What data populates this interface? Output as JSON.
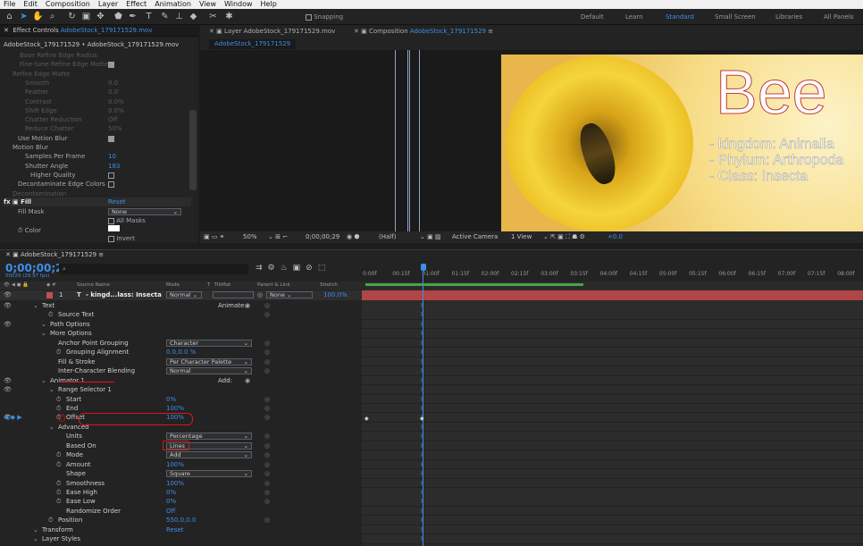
{
  "menu": [
    "File",
    "Edit",
    "Composition",
    "Layer",
    "Effect",
    "Animation",
    "View",
    "Window",
    "Help"
  ],
  "toolbar": {
    "snapping": "Snapping",
    "workspaces": [
      "Default",
      "Learn",
      "Standard",
      "Small Screen",
      "Libraries",
      "All Panels"
    ],
    "active_workspace": "Standard"
  },
  "effect_panel": {
    "tab_label": "Effect Controls",
    "tab_file": "AdobeStock_179171529.mov",
    "path": "AdobeStock_179171529 • AdobeStock_179171529.mov",
    "rows": [
      {
        "label": "Base Refine Edge Radius",
        "value": "",
        "dim": true
      },
      {
        "label": "Fine-tune Refine Edge Matte",
        "value": "",
        "dim": true
      },
      {
        "label": "Refine Edge Matte",
        "value": "",
        "dim": true
      },
      {
        "label": "Smooth",
        "value": "0.0",
        "dim": true
      },
      {
        "label": "Feather",
        "value": "0.0",
        "dim": true
      },
      {
        "label": "Contrast",
        "value": "0.0%",
        "dim": true
      },
      {
        "label": "Shift Edge",
        "value": "0.0%",
        "dim": true
      },
      {
        "label": "Chatter Reduction",
        "value": "Off",
        "dim": true
      },
      {
        "label": "Reduce Chatter",
        "value": "50%",
        "dim": true
      },
      {
        "label": "Use Motion Blur",
        "value": "",
        "dim": false
      },
      {
        "label": "Motion Blur",
        "value": "",
        "dim": false
      },
      {
        "label": "Samples Per Frame",
        "value": "10",
        "dim": false
      },
      {
        "label": "Shutter Angle",
        "value": "183",
        "dim": false
      },
      {
        "label": "Higher Quality",
        "value": "",
        "dim": false
      },
      {
        "label": "Decontaminate Edge Colors",
        "value": "",
        "dim": false
      },
      {
        "label": "Decontamination",
        "value": "",
        "dim": true
      }
    ],
    "fill_label": "Fill",
    "reset": "Reset",
    "fill_mask": "Fill Mask",
    "fill_mask_value": "None",
    "all_masks": "All Masks",
    "color": "Color",
    "invert": "Invert"
  },
  "viewer": {
    "layer_tab": "Layer AdobeStock_179171529.mov",
    "comp_tab_prefix": "Composition",
    "comp_tab_name": "AdobeStock_179171529",
    "comp_subtab": "AdobeStock_179171529",
    "bee_title": "Bee",
    "bee_lines": [
      "- kingdom: Animalia",
      "- Phylum: Arthropoda",
      "- Class: Insecta"
    ],
    "zoom": "50%",
    "timecode": "0;00;00;29",
    "quality": "(Half)",
    "camera": "Active Camera",
    "view": "1 View",
    "exposure": "+0.0"
  },
  "timeline": {
    "tab": "AdobeStock_179171529",
    "timecode": "0;00;00;29",
    "fps": "00029 (29.97 fps)",
    "cols": {
      "source": "Source Name",
      "mode": "Mode",
      "t": "T",
      "trkmat": "TrkMat",
      "parent": "Parent & Link",
      "stretch": "Stretch"
    },
    "ruler": [
      "0:00f",
      "00:15f",
      "01:00f",
      "01:15f",
      "02:00f",
      "02:15f",
      "03:00f",
      "03:15f",
      "04:00f",
      "04:15f",
      "05:00f",
      "05:15f",
      "06:00f",
      "06:15f",
      "07:00f",
      "07:15f",
      "08:00f"
    ],
    "layer": {
      "num": "1",
      "type": "T",
      "name": "- kingd...lass: Insecta",
      "mode": "Normal",
      "parent": "None",
      "stretch": "100.0%"
    },
    "rows": [
      {
        "indent": 3,
        "label": "Text",
        "value": "",
        "extra": "Animate:"
      },
      {
        "indent": 5,
        "label": "Source Text",
        "value": ""
      },
      {
        "indent": 4,
        "label": "Path Options",
        "value": ""
      },
      {
        "indent": 4,
        "label": "More Options",
        "value": ""
      },
      {
        "indent": 5,
        "label": "Anchor Point Grouping",
        "value": "Character",
        "dd": true
      },
      {
        "indent": 6,
        "label": "Grouping Alignment",
        "value": "0.0,0.0 %"
      },
      {
        "indent": 5,
        "label": "Fill & Stroke",
        "value": "Per Character Palette",
        "dd": true
      },
      {
        "indent": 5,
        "label": "Inter-Character Blending",
        "value": "Normal",
        "dd": true
      },
      {
        "indent": 4,
        "label": "Animator 1",
        "value": "",
        "extra": "Add:"
      },
      {
        "indent": 5,
        "label": "Range Selector 1",
        "value": ""
      },
      {
        "indent": 6,
        "label": "Start",
        "value": "0%"
      },
      {
        "indent": 6,
        "label": "End",
        "value": "100%"
      },
      {
        "indent": 6,
        "label": "Offset",
        "value": "100%"
      },
      {
        "indent": 5,
        "label": "Advanced",
        "value": ""
      },
      {
        "indent": 6,
        "label": "Units",
        "value": "Percentage",
        "dd": true
      },
      {
        "indent": 6,
        "label": "Based On",
        "value": "Lines",
        "dd": true
      },
      {
        "indent": 6,
        "label": "Mode",
        "value": "Add",
        "dd": true
      },
      {
        "indent": 6,
        "label": "Amount",
        "value": "100%"
      },
      {
        "indent": 6,
        "label": "Shape",
        "value": "Square",
        "dd": true
      },
      {
        "indent": 6,
        "label": "Smoothness",
        "value": "100%"
      },
      {
        "indent": 6,
        "label": "Ease High",
        "value": "0%"
      },
      {
        "indent": 6,
        "label": "Ease Low",
        "value": "0%"
      },
      {
        "indent": 6,
        "label": "Randomize Order",
        "value": "Off"
      },
      {
        "indent": 5,
        "label": "Position",
        "value": "550.0,0.0"
      },
      {
        "indent": 3,
        "label": "Transform",
        "value": "Reset"
      },
      {
        "indent": 3,
        "label": "Layer Styles",
        "value": ""
      }
    ]
  },
  "colors": {
    "accent": "#3d8ee8",
    "layer_bar": "#c24f4f",
    "annotation": "#e0141b"
  }
}
